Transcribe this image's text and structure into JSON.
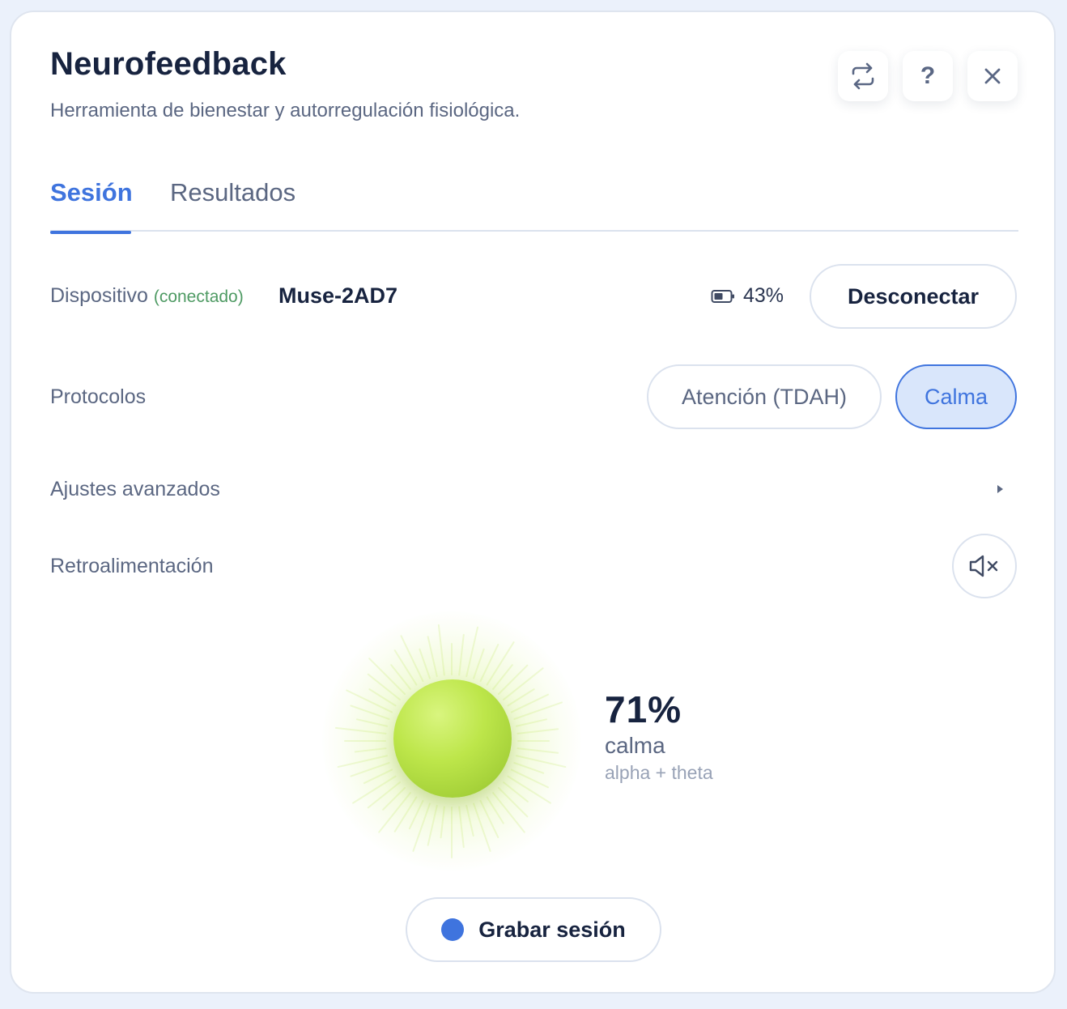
{
  "header": {
    "title": "Neurofeedback",
    "subtitle": "Herramienta de bienestar y autorregulación fisiológica."
  },
  "toolbar": {
    "switch_icon": "swap-arrows-icon",
    "help_label": "?",
    "close_icon": "close-icon"
  },
  "tabs": [
    {
      "label": "Sesión",
      "active": true
    },
    {
      "label": "Resultados",
      "active": false
    }
  ],
  "device": {
    "label": "Dispositivo",
    "status": "(conectado)",
    "name": "Muse-2AD7",
    "battery": "43%",
    "battery_icon": "battery-icon",
    "disconnect_label": "Desconectar"
  },
  "protocols": {
    "label": "Protocolos",
    "options": [
      {
        "label": "Atención (TDAH)",
        "selected": false
      },
      {
        "label": "Calma",
        "selected": true
      }
    ]
  },
  "advanced": {
    "label": "Ajustes avanzados",
    "icon": "chevron-right-icon"
  },
  "feedback": {
    "label": "Retroalimentación",
    "mute_icon": "speaker-muted-icon",
    "value": "71%",
    "level": 0.71,
    "metric": "calma",
    "bands": "alpha + theta"
  },
  "record": {
    "label": "Grabar sesión"
  },
  "colors": {
    "accent": "#3f74de",
    "connected": "#4e9a63",
    "orb": "#bde64a"
  }
}
